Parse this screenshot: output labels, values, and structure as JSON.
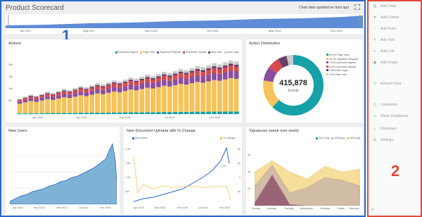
{
  "dashboard": {
    "title": "Product Scorecard",
    "updated": "Chart data updated an hour ago",
    "marker": "1"
  },
  "timeline": {
    "labels": [
      "Jan 2017",
      "Aug 2017",
      "Mar 2018",
      "Oct 2018",
      "May 2019",
      "Dec 2019"
    ]
  },
  "actions": {
    "title": "Actions",
    "legend": [
      "Document Signed",
      "Page View",
      "Signature Request",
      "Document Upload",
      "New User",
      "User Login"
    ],
    "colors": [
      "#16a0a8",
      "#f5c35a",
      "#8b4f9e",
      "#d64b4b",
      "#6a3d68",
      "#c9c9c9"
    ],
    "y_ticks": [
      "20K",
      "15K",
      "10K",
      "5K"
    ],
    "x_ticks": [
      "Apr 2018",
      "Sep 2018",
      "Feb 2019",
      "Jul 2019",
      "Dec 2019"
    ]
  },
  "distribution": {
    "title": "Action Distribution",
    "total": "415,878",
    "unit": "Events",
    "legend": [
      "62.1% Page View",
      "15.4% Signature Request",
      "7.5% Document Signed",
      "6.4% Document Upload",
      "4.8% User Login",
      "3.9% New User"
    ],
    "colors": [
      "#16a0a8",
      "#f5c35a",
      "#8b4f9e",
      "#d64b4b",
      "#6a3d68",
      "#c9c9c9"
    ]
  },
  "new_users": {
    "title": "New Users",
    "x_ticks": [
      "Apr 2018",
      "Sep 2018",
      "Feb 2019",
      "Jul 2019",
      "Dec 2019"
    ]
  },
  "uploads": {
    "title": "New Document Uploads with % Change",
    "legend_left": "Doc ments",
    "legend_right": "% Change",
    "y_left": [
      "2.4K",
      "1.8K",
      "1.2K",
      "600"
    ],
    "y_right": [
      "80",
      "40",
      "0",
      "-40"
    ],
    "x_ticks": [
      "Apr 2018",
      "Sep 2018",
      "Feb 2019",
      "Jul 2019",
      "Dec 2019"
    ],
    "last_label": "1.2K"
  },
  "signatures": {
    "title": "Signatures (week over week)",
    "legend": [
      "2017 Avg",
      "2018 Avg",
      "2019 Avg"
    ],
    "y_ticks": [
      "60",
      "40",
      "20"
    ],
    "x_ticks": [
      "Sunday",
      "Monday",
      "Tuesday",
      "Wednesday",
      "Thursday",
      "Friday",
      "Saturday"
    ]
  },
  "sidebar": {
    "marker": "2",
    "items": [
      {
        "label": "Add Chart",
        "icon": "chart-icon"
      },
      {
        "label": "Add Control",
        "icon": "filter-icon"
      },
      {
        "label": "Add Ruler",
        "icon": "ruler-icon"
      },
      {
        "label": "Add Text",
        "icon": "text-icon"
      },
      {
        "label": "Add Link",
        "icon": "link-icon"
      },
      {
        "label": "Add Image",
        "icon": "image-icon"
      },
      {
        "label": "Refresh Data",
        "icon": "refresh-icon"
      },
      {
        "label": "Comments",
        "icon": "comment-icon"
      },
      {
        "label": "Share Dashboard",
        "icon": "share-icon"
      },
      {
        "label": "Download",
        "icon": "download-icon"
      },
      {
        "label": "Settings",
        "icon": "gear-icon"
      }
    ],
    "collapse": "»"
  }
}
